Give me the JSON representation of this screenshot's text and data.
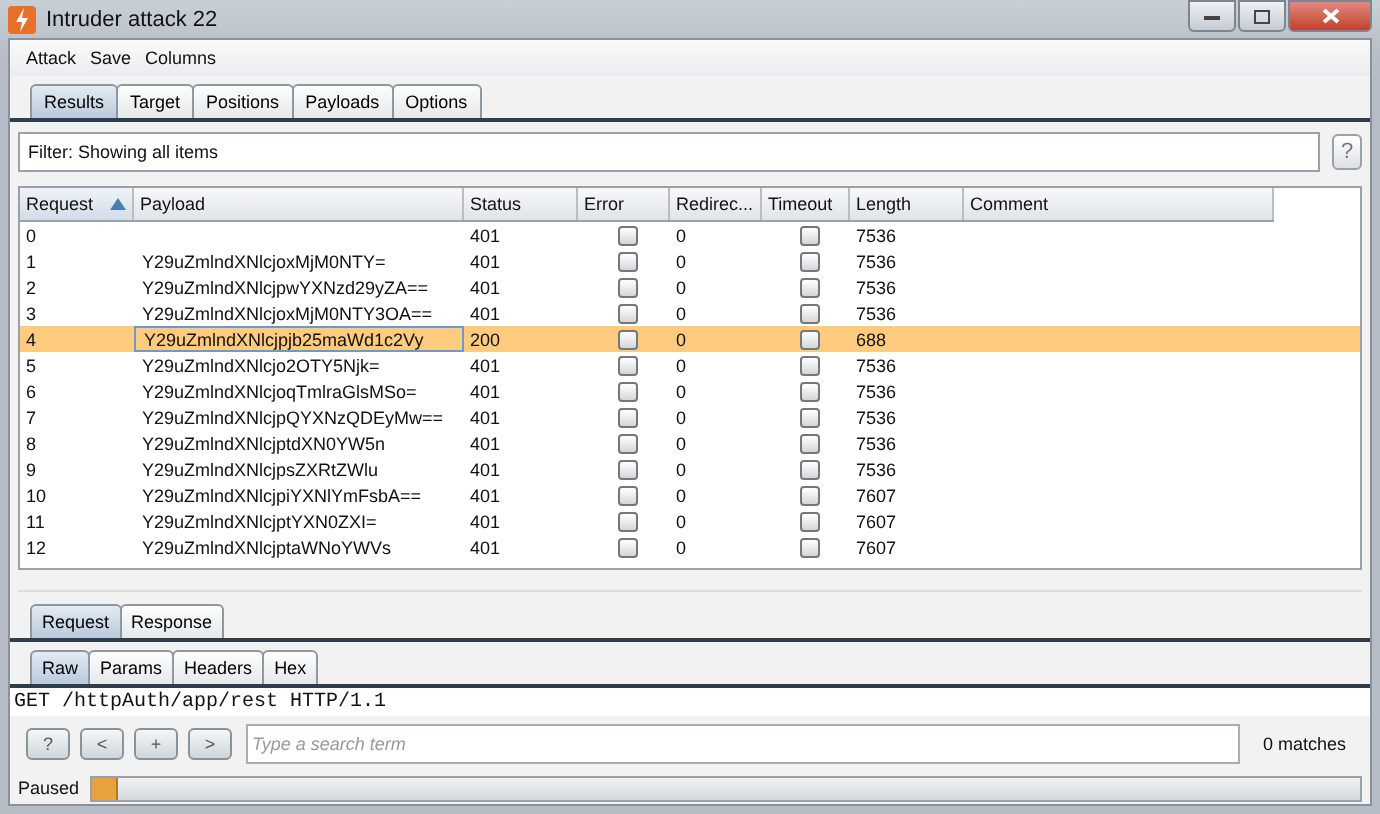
{
  "window": {
    "title": "Intruder attack 22"
  },
  "menu": [
    "Attack",
    "Save",
    "Columns"
  ],
  "tabs": [
    {
      "label": "Results",
      "selected": true
    },
    {
      "label": "Target",
      "selected": false
    },
    {
      "label": "Positions",
      "selected": false
    },
    {
      "label": "Payloads",
      "selected": false
    },
    {
      "label": "Options",
      "selected": false
    }
  ],
  "filter": {
    "text": "Filter:  Showing all items",
    "help": "?"
  },
  "table": {
    "columns": [
      {
        "label": "Request",
        "sorted": true
      },
      {
        "label": "Payload",
        "sorted": false
      },
      {
        "label": "Status",
        "sorted": false
      },
      {
        "label": "Error",
        "sorted": false
      },
      {
        "label": "Redirec...",
        "sorted": false
      },
      {
        "label": "Timeout",
        "sorted": false
      },
      {
        "label": "Length",
        "sorted": false
      },
      {
        "label": "Comment",
        "sorted": false
      }
    ],
    "rows": [
      {
        "request": "0",
        "payload": "",
        "status": "401",
        "error": false,
        "redirects": "0",
        "timeout": false,
        "length": "7536",
        "selected": false
      },
      {
        "request": "1",
        "payload": "Y29uZmlndXNlcjoxMjM0NTY=",
        "status": "401",
        "error": false,
        "redirects": "0",
        "timeout": false,
        "length": "7536",
        "selected": false
      },
      {
        "request": "2",
        "payload": "Y29uZmlndXNlcjpwYXNzd29yZA==",
        "status": "401",
        "error": false,
        "redirects": "0",
        "timeout": false,
        "length": "7536",
        "selected": false
      },
      {
        "request": "3",
        "payload": "Y29uZmlndXNlcjoxMjM0NTY3OA==",
        "status": "401",
        "error": false,
        "redirects": "0",
        "timeout": false,
        "length": "7536",
        "selected": false
      },
      {
        "request": "4",
        "payload": "Y29uZmlndXNlcjpjb25maWd1c2Vy",
        "status": "200",
        "error": false,
        "redirects": "0",
        "timeout": false,
        "length": "688",
        "selected": true
      },
      {
        "request": "5",
        "payload": "Y29uZmlndXNlcjo2OTY5Njk=",
        "status": "401",
        "error": false,
        "redirects": "0",
        "timeout": false,
        "length": "7536",
        "selected": false
      },
      {
        "request": "6",
        "payload": "Y29uZmlndXNlcjoqTmlraGlsMSo=",
        "status": "401",
        "error": false,
        "redirects": "0",
        "timeout": false,
        "length": "7536",
        "selected": false
      },
      {
        "request": "7",
        "payload": "Y29uZmlndXNlcjpQYXNzQDEyMw==",
        "status": "401",
        "error": false,
        "redirects": "0",
        "timeout": false,
        "length": "7536",
        "selected": false
      },
      {
        "request": "8",
        "payload": "Y29uZmlndXNlcjptdXN0YW5n",
        "status": "401",
        "error": false,
        "redirects": "0",
        "timeout": false,
        "length": "7536",
        "selected": false
      },
      {
        "request": "9",
        "payload": "Y29uZmlndXNlcjpsZXRtZWlu",
        "status": "401",
        "error": false,
        "redirects": "0",
        "timeout": false,
        "length": "7536",
        "selected": false
      },
      {
        "request": "10",
        "payload": "Y29uZmlndXNlcjpiYXNlYmFsbA==",
        "status": "401",
        "error": false,
        "redirects": "0",
        "timeout": false,
        "length": "7607",
        "selected": false
      },
      {
        "request": "11",
        "payload": "Y29uZmlndXNlcjptYXN0ZXI=",
        "status": "401",
        "error": false,
        "redirects": "0",
        "timeout": false,
        "length": "7607",
        "selected": false
      },
      {
        "request": "12",
        "payload": "Y29uZmlndXNlcjptaWNoYWVs",
        "status": "401",
        "error": false,
        "redirects": "0",
        "timeout": false,
        "length": "7607",
        "selected": false
      }
    ]
  },
  "detail_tabs": [
    {
      "label": "Request",
      "selected": true
    },
    {
      "label": "Response",
      "selected": false
    }
  ],
  "view_tabs": [
    {
      "label": "Raw",
      "selected": true
    },
    {
      "label": "Params",
      "selected": false
    },
    {
      "label": "Headers",
      "selected": false
    },
    {
      "label": "Hex",
      "selected": false
    }
  ],
  "request_text": "GET /httpAuth/app/rest HTTP/1.1",
  "search": {
    "buttons": [
      "?",
      "<",
      "+",
      ">"
    ],
    "placeholder": "Type a search term",
    "matches": "0 matches"
  },
  "status": {
    "label": "Paused",
    "level": 0.02
  }
}
